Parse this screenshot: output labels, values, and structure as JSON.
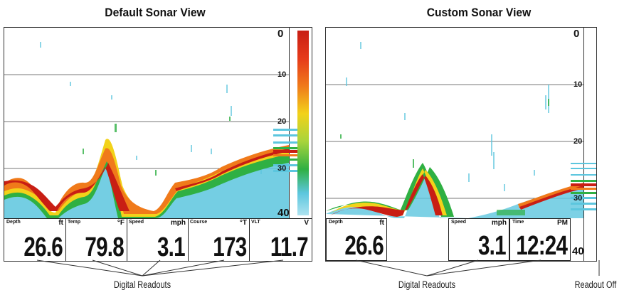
{
  "default_view": {
    "title": "Default Sonar View",
    "depth_scale": [
      "0",
      "10",
      "20",
      "30",
      "40"
    ],
    "readouts": [
      {
        "label": "Depth",
        "unit": "ft",
        "value": "26.6"
      },
      {
        "label": "Temp",
        "unit": "°F",
        "value": "79.8"
      },
      {
        "label": "Speed",
        "unit": "mph",
        "value": "3.1"
      },
      {
        "label": "Course",
        "unit": "°T",
        "value": "173"
      },
      {
        "label": "VLT",
        "unit": "V",
        "value": "11.7"
      }
    ]
  },
  "custom_view": {
    "title": "Custom Sonar View",
    "depth_scale": [
      "0",
      "10",
      "20",
      "30",
      "40"
    ],
    "readouts": [
      {
        "label": "Depth",
        "unit": "ft",
        "value": "26.6"
      },
      {
        "label": "Speed",
        "unit": "mph",
        "value": "3.1"
      },
      {
        "label": "Time",
        "unit": "PM",
        "value": "12:24"
      }
    ]
  },
  "captions": {
    "digital_readouts_left": "Digital Readouts",
    "digital_readouts_right": "Digital Readouts",
    "readout_off": "Readout Off"
  },
  "colors": {
    "bottom_red": "#c81e14",
    "bottom_orange": "#f07a1a",
    "bottom_yellow": "#f2d21a",
    "fish_green": "#2fb043",
    "water_cyan": "#5cc6de"
  }
}
